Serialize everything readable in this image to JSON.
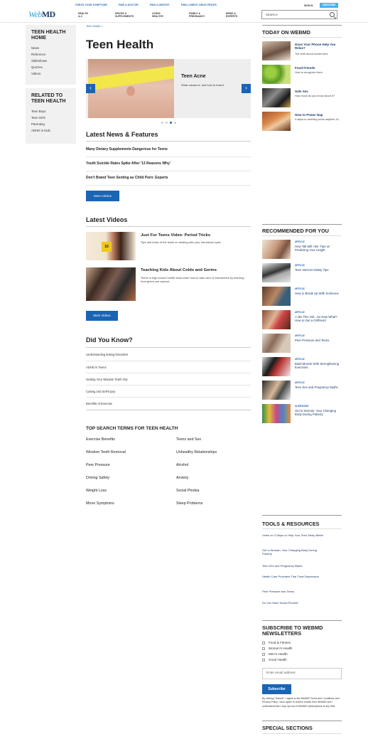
{
  "header": {
    "top_links": [
      "CHECK YOUR SYMPTOMS",
      "FIND A DOCTOR",
      "FIND A DENTIST",
      "FIND LOWEST DRUG PRICES"
    ],
    "sign_in": "SIGN IN",
    "subscribe": "SUBSCRIBE",
    "logo_w": "Web",
    "logo_m": "MD",
    "nav": [
      [
        "HEALTH",
        "A-Z"
      ],
      [
        "DRUGS &",
        "SUPPLEMENTS"
      ],
      [
        "LIVING",
        "HEALTHY"
      ],
      [
        "FAMILY &",
        "PREGNANCY"
      ],
      [
        "NEWS &",
        "EXPERTS"
      ]
    ],
    "search_placeholder": "SEARCH"
  },
  "sidebar": {
    "home_title": "TEEN HEALTH HOME",
    "home_items": [
      "News",
      "Reference",
      "Slideshows",
      "Quizzes",
      "Videos"
    ],
    "related_title": "RELATED TO TEEN HEALTH",
    "related_items": [
      "Teen Boys",
      "Teen Girls",
      "Parenting",
      "ADHD in Kids"
    ]
  },
  "main": {
    "breadcrumb": "Teen Health >",
    "title": "Teen Health",
    "slide": {
      "title": "Teen Acne",
      "desc": "What causes it, and how to treat it."
    },
    "news_heading": "Latest News & Features",
    "news": [
      "Many Dietary Supplements Dangerous for Teens",
      "Youth Suicide Rates Spike After '13 Reasons Why'",
      "Don't Brand Teen Sexting as Child Porn: Experts"
    ],
    "more_articles": "More Articles",
    "videos_heading": "Latest Videos",
    "videos": [
      {
        "title": "Just For Teens Video: Period Tricks",
        "desc": "Tips and tricks of the trade on dealing with your menstrual cycle."
      },
      {
        "title": "Teaching Kids About Colds and Germs",
        "desc": "Teens in high school health class learn how to take care of themselves by learning how germs are spread."
      }
    ],
    "more_videos": "More Videos",
    "dyk_heading": "Did You Know?",
    "dyk": [
      "Understanding Eating Disorders",
      "ADHD in Teens",
      "Getting Your Wisdom Teeth Out",
      "Cutting and Self-Injury",
      "Benefits of Exercise"
    ],
    "search_terms_heading": "TOP SEARCH TERMS FOR TEEN HEALTH",
    "search_terms_left": [
      "Exercise Benefits",
      "Wisdom Teeth Removal",
      "Peer Pressure",
      "Driving Safety",
      "Weight Loss",
      "Mono Symptoms"
    ],
    "search_terms_right": [
      "Teens and Sex",
      "Unhealthy Relationships",
      "Alcohol",
      "Anxiety",
      "Social Phobia",
      "Sleep Problems"
    ]
  },
  "right": {
    "today_heading": "TODAY ON WEBMD",
    "today": [
      {
        "title": "Does Your Phone Help You Relax?",
        "desc": "The truth about screen time."
      },
      {
        "title": "Food Friends",
        "desc": "How to recognize them."
      },
      {
        "title": "Safe Sex",
        "desc": "How much do you know about it?"
      },
      {
        "title": "How to Power Nap",
        "desc": "4 steps to catching some daytime Zs."
      }
    ],
    "rec_heading": "RECOMMENDED FOR YOU",
    "rec": [
      {
        "kind": "ARTICLE",
        "title": "How Tall Will I Be: Tips on Predicting Your Height"
      },
      {
        "kind": "ARTICLE",
        "title": "Teen Internet Safety Tips"
      },
      {
        "kind": "ARTICLE",
        "title": "How to Break Up With Someone"
      },
      {
        "kind": "ARTICLE",
        "title": "I Like This Girl...So Now What? How to Get a Girlfriend"
      },
      {
        "kind": "ARTICLE",
        "title": "Peer Pressure and Teens"
      },
      {
        "kind": "ARTICLE",
        "title": "Build Muscle With Strengthening Exercises"
      },
      {
        "kind": "ARTICLE",
        "title": "Teen Sex and Pregnancy Myths"
      },
      {
        "kind": "SLIDESHOW",
        "title": "Girl to Woman: Your Changing Body During Puberty"
      }
    ],
    "tools_heading": "TOOLS & RESOURCES",
    "tools": [
      "Video on 3 Steps to Help Your Teen Sleep Better",
      "Girl to Woman: Your Changing Body During Puberty",
      "Teen Sex and Pregnancy Myths",
      "Health Care Providers That Treat Depression",
      "Peer Pressure and Teens",
      "Do You Have Social Phobia?"
    ],
    "newsletter_heading": "SUBSCRIBE TO WEBMD NEWSLETTERS",
    "newsletters": [
      "Food & Fitness",
      "Women's Health",
      "Men's Health",
      "Good Health"
    ],
    "email_placeholder": "Enter email address",
    "subscribe": "Subscribe",
    "legal": "By clicking \"Submit,\" I agree to the WebMD Terms and Conditions and Privacy Policy. I also agree to receive emails from WebMD and I understand that I may opt out of WebMD subscriptions at any time.",
    "special_heading": "SPECIAL SECTIONS"
  }
}
